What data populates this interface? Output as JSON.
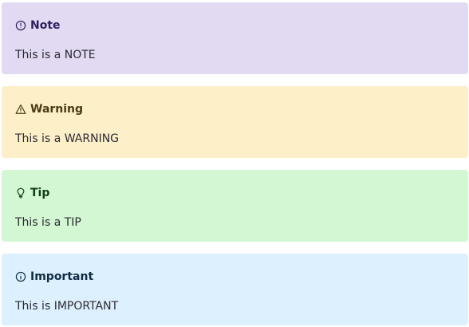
{
  "callouts": [
    {
      "id": "note",
      "icon": "info-circle-icon",
      "title": "Note",
      "body": "This is a NOTE",
      "colors": {
        "background": "#e2daf2",
        "title": "#2e1f5e",
        "text": "#2b2a33"
      }
    },
    {
      "id": "warning",
      "icon": "warning-triangle-icon",
      "title": "Warning",
      "body": "This is a WARNING",
      "colors": {
        "background": "#fdf0c9",
        "title": "#4b3a12",
        "text": "#2b2a33"
      }
    },
    {
      "id": "tip",
      "icon": "lightbulb-icon",
      "title": "Tip",
      "body": "This is a TIP",
      "colors": {
        "background": "#d2f7d2",
        "title": "#123d12",
        "text": "#2b2a33"
      }
    },
    {
      "id": "important",
      "icon": "info-circle-icon",
      "title": "Important",
      "body": "This is IMPORTANT",
      "colors": {
        "background": "#ddf0fd",
        "title": "#0f2c44",
        "text": "#2b2a33"
      }
    }
  ]
}
